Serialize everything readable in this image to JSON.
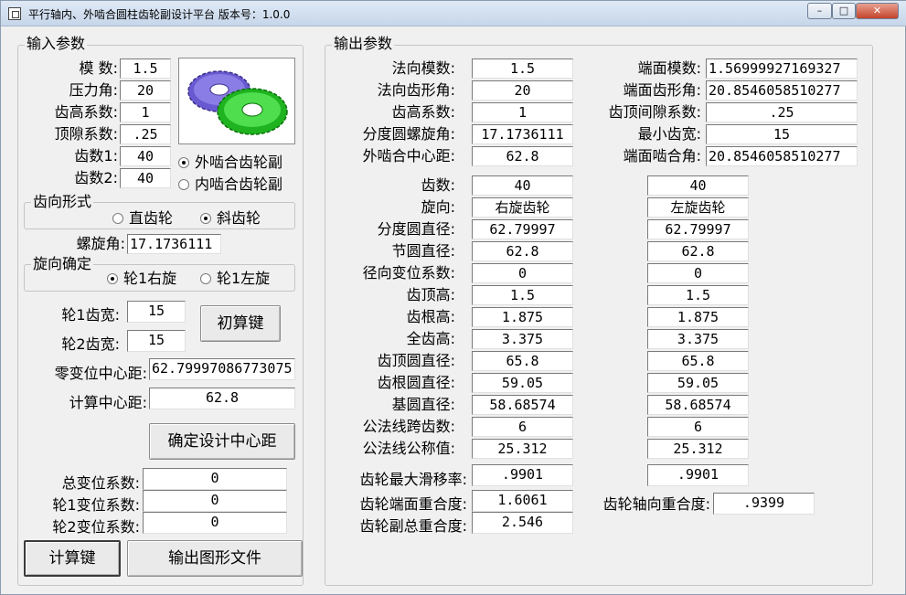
{
  "window": {
    "title": "平行轴内、外啮合圆柱齿轮副设计平台 版本号：1.0.0",
    "controls": {
      "minimize": "–",
      "maximize": "□",
      "close": "✕"
    }
  },
  "input": {
    "title": "输入参数",
    "module_label": "模    数:",
    "module": "1.5",
    "pressure_angle_label": "压力角:",
    "pressure_angle": "20",
    "addendum_coef_label": "齿高系数:",
    "addendum_coef": "1",
    "clearance_coef_label": "顶隙系数:",
    "clearance_coef": ".25",
    "teeth1_label": "齿数1:",
    "teeth1": "40",
    "teeth2_label": "齿数2:",
    "teeth2": "40",
    "mesh_external": "外啮合齿轮副",
    "mesh_internal": "内啮合齿轮副",
    "tooth_form_title": "齿向形式",
    "spur_label": "直齿轮",
    "helical_label": "斜齿轮",
    "helix_angle_label": "螺旋角:",
    "helix_angle": "17.1736111",
    "hand_title": "旋向确定",
    "hand_right": "轮1右旋",
    "hand_left": "轮1左旋",
    "width1_label": "轮1齿宽:",
    "width1": "15",
    "width2_label": "轮2齿宽:",
    "width2": "15",
    "initial_calc_button": "初算键",
    "zero_shift_center_label": "零变位中心距:",
    "zero_shift_center": "62.79997086773075",
    "calc_center_label": "计算中心距:",
    "calc_center": "62.8",
    "confirm_center_button": "确定设计中心距",
    "total_shift_label": "总变位系数:",
    "total_shift": "0",
    "shift1_label": "轮1变位系数:",
    "shift1": "0",
    "shift2_label": "轮2变位系数:",
    "shift2": "0",
    "calculate_button": "计算键",
    "export_button": "输出图形文件"
  },
  "output": {
    "title": "输出参数",
    "normal_module_label": "法向模数:",
    "normal_module": "1.5",
    "normal_pressure_label": "法向齿形角:",
    "normal_pressure": "20",
    "addendum_coef_label": "齿高系数:",
    "addendum_coef": "1",
    "helix_angle_label": "分度圆螺旋角:",
    "helix_angle": "17.1736111",
    "center_distance_label": "外啮合中心距:",
    "center_distance": "62.8",
    "transverse_module_label": "端面模数:",
    "transverse_module": "1.56999927169327",
    "transverse_pressure_label": "端面齿形角:",
    "transverse_pressure": "20.8546058510277",
    "clearance_coef_label": "齿顶间隙系数:",
    "clearance_coef": ".25",
    "min_width_label": "最小齿宽:",
    "min_width": "15",
    "transverse_mesh_label": "端面啮合角:",
    "transverse_mesh": "20.8546058510277",
    "rows": [
      {
        "label": "齿数:",
        "g1": "40",
        "g2": "40"
      },
      {
        "label": "旋向:",
        "g1": "右旋齿轮",
        "g2": "左旋齿轮"
      },
      {
        "label": "分度圆直径:",
        "g1": "62.79997",
        "g2": "62.79997"
      },
      {
        "label": "节圆直径:",
        "g1": "62.8",
        "g2": "62.8"
      },
      {
        "label": "径向变位系数:",
        "g1": "0",
        "g2": "0"
      },
      {
        "label": "齿顶高:",
        "g1": "1.5",
        "g2": "1.5"
      },
      {
        "label": "齿根高:",
        "g1": "1.875",
        "g2": "1.875"
      },
      {
        "label": "全齿高:",
        "g1": "3.375",
        "g2": "3.375"
      },
      {
        "label": "齿顶圆直径:",
        "g1": "65.8",
        "g2": "65.8"
      },
      {
        "label": "齿根圆直径:",
        "g1": "59.05",
        "g2": "59.05"
      },
      {
        "label": "基圆直径:",
        "g1": "58.68574",
        "g2": "58.68574"
      },
      {
        "label": "公法线跨齿数:",
        "g1": "6",
        "g2": "6"
      },
      {
        "label": "公法线公称值:",
        "g1": "25.312",
        "g2": "25.312"
      }
    ],
    "max_slip_label": "齿轮最大滑移率:",
    "max_slip1": ".9901",
    "max_slip2": ".9901",
    "transverse_contact_label": "齿轮端面重合度:",
    "transverse_contact": "1.6061",
    "axial_contact_label": "齿轮轴向重合度:",
    "axial_contact": ".9399",
    "total_contact_label": "齿轮副总重合度:",
    "total_contact": "2.546"
  }
}
